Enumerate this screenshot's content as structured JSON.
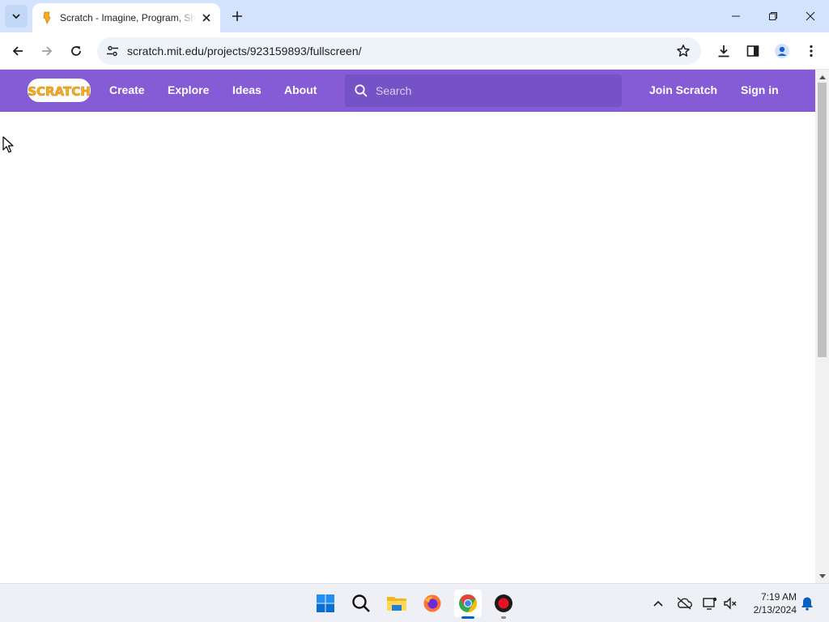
{
  "browser": {
    "tab": {
      "title": "Scratch - Imagine, Program, Share",
      "favicon": "scratch-cat-icon"
    },
    "url": "scratch.mit.edu/projects/923159893/fullscreen/"
  },
  "scratch_header": {
    "logo_text": "SCRATCH",
    "nav": {
      "create": "Create",
      "explore": "Explore",
      "ideas": "Ideas",
      "about": "About"
    },
    "search": {
      "placeholder": "Search",
      "value": ""
    },
    "join": "Join Scratch",
    "sign_in": "Sign in",
    "colors": {
      "header_bg": "#855cd6",
      "search_bg": "#7553c7",
      "logo_fill": "#ffab19"
    }
  },
  "taskbar": {
    "apps": [
      "windows-start-icon",
      "search-icon",
      "file-explorer-icon",
      "firefox-icon",
      "chrome-icon",
      "screen-recorder-icon"
    ],
    "clock": {
      "time": "7:19 AM",
      "date": "2/13/2024"
    }
  }
}
